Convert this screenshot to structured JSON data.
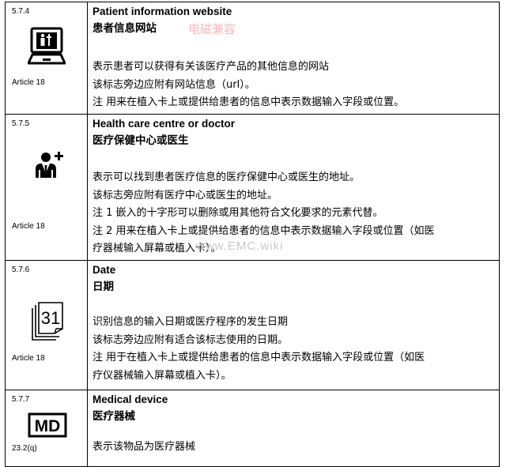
{
  "watermark": "www.EMC.wiki",
  "watermark_red": "电磁兼容",
  "rows": [
    {
      "ref": "5.7.4",
      "article": "Article 18",
      "title_en": "Patient information website",
      "title_zh": "患者信息网站",
      "desc": [
        "表示患者可以获得有关该医疗产品的其他信息的网站",
        "该标志旁边应附有网站信息（url）。",
        "注  用来在植入卡上或提供给患者的信息中表示数据输入字段或位置。"
      ]
    },
    {
      "ref": "5.7.5",
      "article": "Article 18",
      "title_en": "Health care centre or doctor",
      "title_zh": "医疗保健中心或医生",
      "desc": [
        "表示可以找到患者医疗信息的医疗保健中心或医生的地址。",
        "该标志旁应附有医疗中心或医生的地址。",
        "注 1  嵌入的十字形可以删除或用其他符合文化要求的元素代替。",
        "注 2 用来在植入卡上或提供给患者的信息中表示数据输入字段或位置（如医",
        "疗器械输入屏幕或植入卡）。"
      ]
    },
    {
      "ref": "5.7.6",
      "article": "Article 18",
      "title_en": "Date",
      "title_zh": "日期",
      "symbol_text": "31",
      "desc": [
        "识别信息的输入日期或医疗程序的发生日期",
        "该标志旁边应附有适合该标志使用的日期。",
        "注  用于在植入卡上或提供给患者的信息中表示数据输入字段或位置（如医",
        "疗仪器械输入屏幕或植入卡）。"
      ]
    },
    {
      "ref": "5.7.7",
      "article": "23.2(q)",
      "title_en": "Medical device",
      "title_zh": "医疗器械",
      "symbol_text": "MD",
      "desc": [
        "表示该物品为医疗器械"
      ]
    }
  ]
}
